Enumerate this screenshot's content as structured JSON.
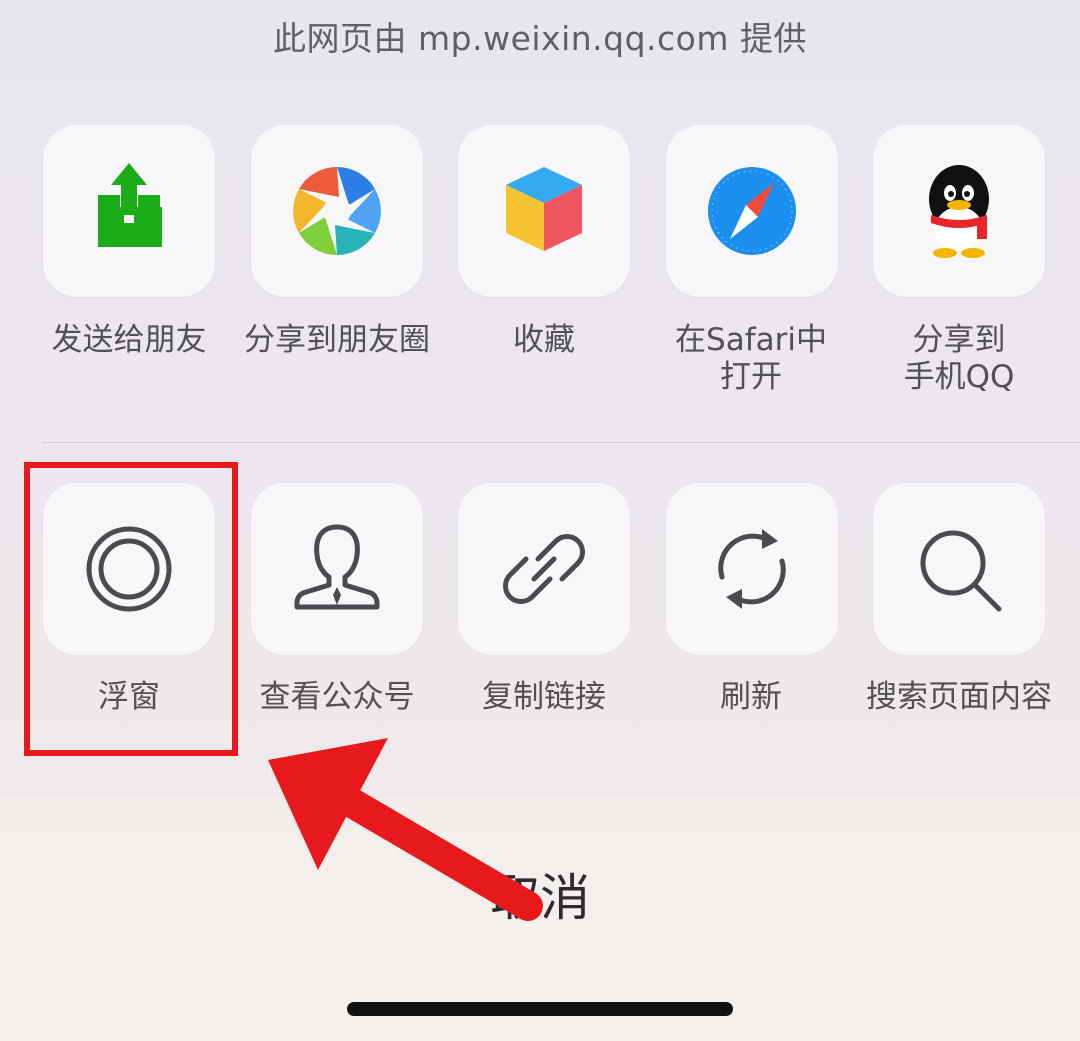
{
  "sheet": {
    "provider_text": "此网页由 mp.weixin.qq.com 提供"
  },
  "share_row": [
    {
      "label": "发送给朋友",
      "icon": "send-to-friend-icon"
    },
    {
      "label": "分享到朋友圈",
      "icon": "moments-aperture-icon"
    },
    {
      "label": "收藏",
      "icon": "favorites-cube-icon"
    },
    {
      "label": "在Safari中\n打开",
      "icon": "safari-compass-icon"
    },
    {
      "label": "分享到\n手机QQ",
      "icon": "qq-penguin-icon"
    }
  ],
  "action_row": [
    {
      "label": "浮窗",
      "icon": "floating-window-icon"
    },
    {
      "label": "查看公众号",
      "icon": "official-account-icon"
    },
    {
      "label": "复制链接",
      "icon": "link-icon"
    },
    {
      "label": "刷新",
      "icon": "refresh-icon"
    },
    {
      "label": "搜索页面内容",
      "icon": "search-icon"
    }
  ],
  "cancel_label": "取消",
  "colors": {
    "highlight": "#e8191c",
    "send_green": "#1aad19",
    "safari_blue": "#1a8ff0"
  }
}
